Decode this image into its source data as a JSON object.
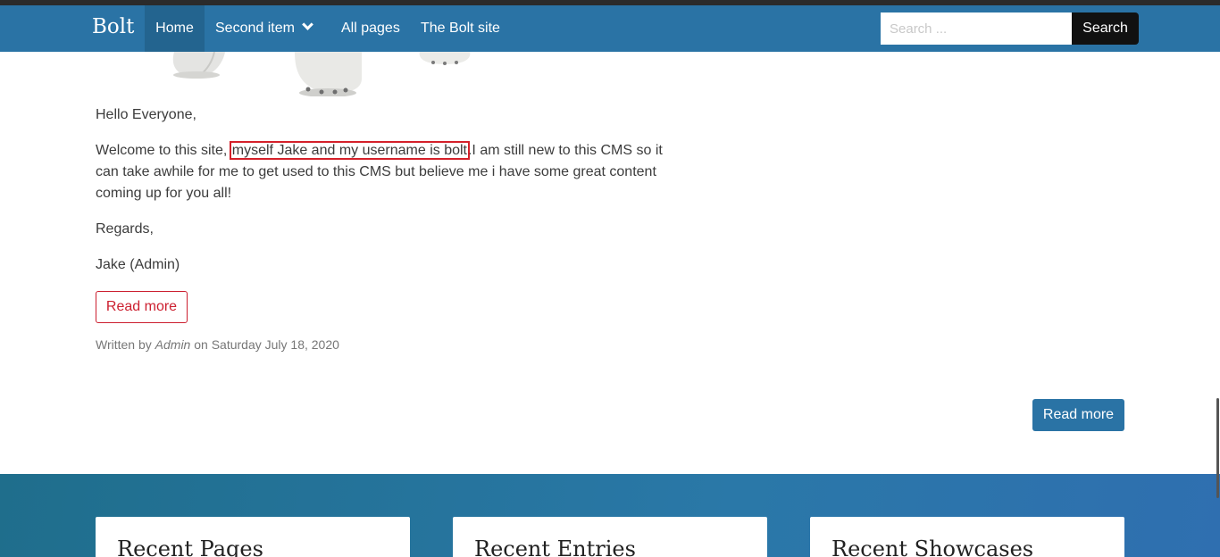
{
  "navbar": {
    "brand": "Bolt",
    "items": [
      {
        "label": "Home"
      },
      {
        "label": "Second item"
      },
      {
        "label": "All pages"
      },
      {
        "label": "The Bolt site"
      }
    ],
    "search": {
      "placeholder": "Search ...",
      "button_label": "Search"
    }
  },
  "post": {
    "greeting": "Hello Everyone,",
    "welcome_prefix": "Welcome to this site, ",
    "welcome_highlight": "myself Jake and my username is bolt",
    "welcome_suffix": ".I am still new to this CMS so it can take awhile for me to get used to this CMS but believe me i have some great content coming up for you all!",
    "regards": "Regards,",
    "signature": "Jake (Admin)",
    "read_more_label": "Read more",
    "meta": {
      "written_by": "Written by",
      "author": "Admin",
      "on": "on",
      "date": "Saturday July 18, 2020"
    }
  },
  "listing": {
    "read_more_label": "Read more"
  },
  "footer": {
    "cards": [
      {
        "title": "Recent Pages"
      },
      {
        "title": "Recent Entries"
      },
      {
        "title": "Recent Showcases"
      }
    ]
  },
  "colors": {
    "navbar": "#2a73a5",
    "accent_red": "#cc1f2f",
    "highlight_box": "#d4202a"
  }
}
